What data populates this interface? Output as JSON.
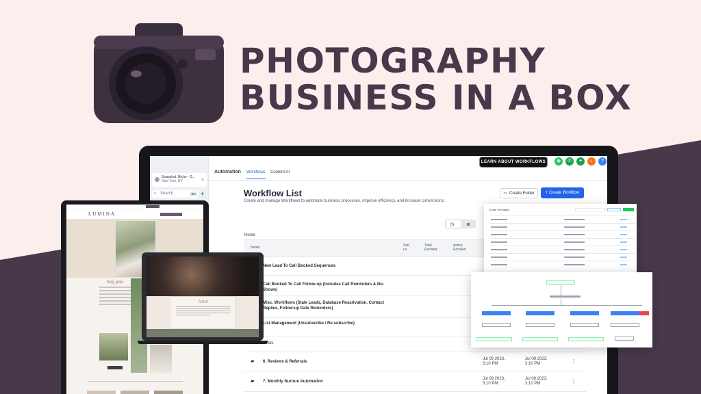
{
  "hero": {
    "line1": "PHOTOGRAPHY",
    "line2": "BUSINESS IN A BOX"
  },
  "colors": {
    "background": "#fbeeed",
    "accent_dark": "#47394a",
    "primary_blue": "#2563eb"
  },
  "app": {
    "account": {
      "name": "Snapshot: Niche - G...",
      "location": "New York, NY"
    },
    "search": {
      "placeholder": "Search",
      "shortcut": "⌘K"
    },
    "nav": {
      "title": "Automation",
      "tabs": [
        "Workflows",
        "Content AI"
      ],
      "learn_button": "LEARN ABOUT WORKFLOWS"
    },
    "workflow_list": {
      "title": "Workflow List",
      "description": "Create and manage Workflows to automate business processes, improve efficiency, and increase conversions.",
      "create_folder": "Create Folder",
      "create_workflow": "+ Create Workflow",
      "breadcrumb": "Home",
      "columns": [
        "Name",
        "Stat us",
        "Total Enrolled",
        "Active Enrolled"
      ],
      "rows": [
        {
          "name": "New Lead To Call Booked Sequences",
          "d1": "",
          "d2": ""
        },
        {
          "name": "Call Booked To Call Follow-up (Includes Call Reminders & No-Shows)",
          "d1": "",
          "d2": ""
        },
        {
          "name": "Misc. Workflows (Stale Leads, Database Reactivation, Contact Replies, Follow-up Date Reminders)",
          "d1": "",
          "d2": ""
        },
        {
          "name": "List Management (Unsubscribe / Re-subscribe)",
          "d1": "",
          "d2": ""
        },
        {
          "name": "...lists",
          "d1": "",
          "d2": ""
        },
        {
          "name": "6. Reviews & Referrals",
          "d1": "Jul 09 2023, 3:10 PM",
          "d2": "Jul 09 2023, 3:10 PM"
        },
        {
          "name": "7. Monthly Nurture Automation",
          "d1": "Jul 09 2023, 3:10 PM",
          "d2": "Jul 09 2023, 3:10 PM"
        }
      ]
    }
  },
  "tablet_site": {
    "logo": "LUMINA",
    "script_heading": "hey you"
  },
  "laptop_site": {
    "script_heading": "love"
  },
  "email_card": {
    "title": "Email Templates"
  },
  "builder_card": {
    "trigger": "Inbound Workflow Trigger"
  }
}
